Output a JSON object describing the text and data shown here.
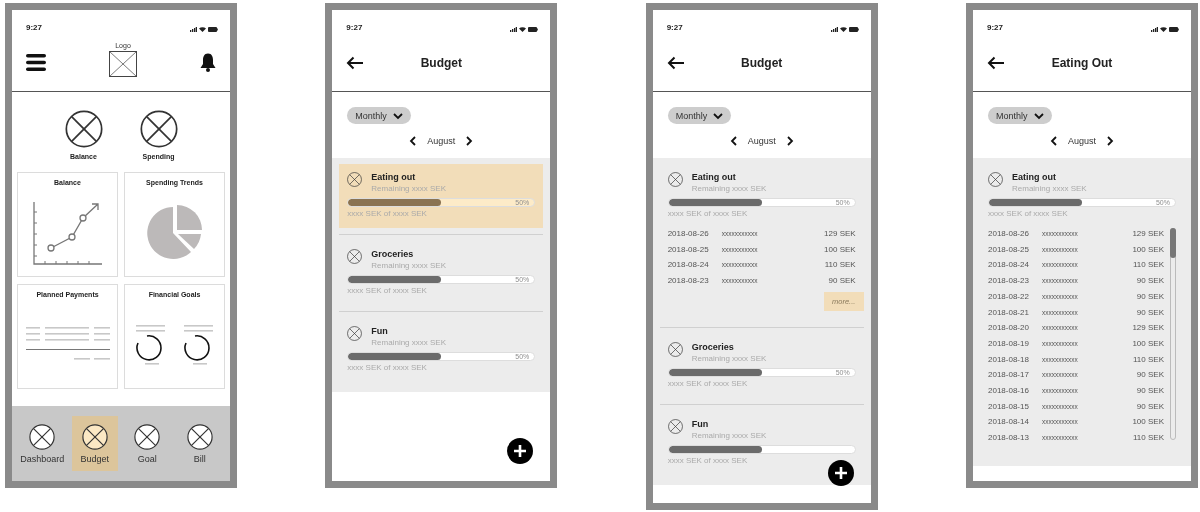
{
  "screens": [
    {
      "kind": "dashboard",
      "time": "9:27",
      "logo_label": "Logo",
      "summary": [
        "Balance",
        "Spending"
      ],
      "cards": [
        {
          "kind": "line",
          "title": "Balance"
        },
        {
          "kind": "pie",
          "title": "Spending Trends"
        },
        {
          "kind": "list",
          "title": "Planned Payments"
        },
        {
          "kind": "goals",
          "title": "Financial Goals"
        }
      ],
      "nav": [
        {
          "label": "Dashboard",
          "selected": false
        },
        {
          "label": "Budget",
          "selected": true
        },
        {
          "label": "Goal",
          "selected": false
        },
        {
          "label": "Bill",
          "selected": false
        }
      ]
    },
    {
      "kind": "budget",
      "time": "9:27",
      "title": "Budget",
      "period": "Monthly",
      "month": "August",
      "categories": [
        {
          "name": "Eating out",
          "remaining": "Remaining xxxx SEK",
          "level": 0.5,
          "percent": "50%",
          "amount": "xxxx SEK of xxxx SEK",
          "selected": true
        },
        {
          "name": "Groceries",
          "remaining": "Remaining xxxx SEK",
          "level": 0.5,
          "percent": "50%",
          "amount": "xxxx SEK of xxxx SEK",
          "selected": false
        },
        {
          "name": "Fun",
          "remaining": "Remaining xxxx SEK",
          "level": 0.5,
          "percent": "50%",
          "amount": "xxxx SEK of xxxx SEK",
          "selected": false
        }
      ]
    },
    {
      "kind": "budget",
      "time": "9:27",
      "title": "Budget",
      "period": "Monthly",
      "month": "August",
      "categories": [
        {
          "name": "Eating out",
          "remaining": "Remaining xxxx SEK",
          "level": 0.5,
          "percent": "50%",
          "amount": "xxxx SEK of xxxx SEK",
          "selected": false,
          "more": "more...",
          "transactions": [
            {
              "date": "2018-08-26",
              "description": "xxxxxxxxxxx",
              "amount": "129 SEK"
            },
            {
              "date": "2018-08-25",
              "description": "xxxxxxxxxxx",
              "amount": "100 SEK"
            },
            {
              "date": "2018-08-24",
              "description": "xxxxxxxxxxx",
              "amount": "110 SEK"
            },
            {
              "date": "2018-08-23",
              "description": "xxxxxxxxxxx",
              "amount": "90 SEK"
            }
          ]
        },
        {
          "name": "Groceries",
          "remaining": "Remaining xxxx SEK",
          "level": 0.5,
          "percent": "50%",
          "amount": "xxxx SEK of xxxx SEK",
          "selected": false
        },
        {
          "name": "Fun",
          "remaining": "Remaining xxxx SEK",
          "level": 0.5,
          "amount": "xxxx SEK of xxxx SEK",
          "selected": false
        }
      ]
    },
    {
      "kind": "detail",
      "time": "9:27",
      "title": "Eating Out",
      "period": "Monthly",
      "month": "August",
      "categories": [
        {
          "name": "Eating out",
          "remaining": "Remaining xxxx SEK",
          "level": 0.5,
          "percent": "50%",
          "amount": "xxxx SEK of xxxx SEK",
          "selected": false,
          "transactions": [
            {
              "date": "2018-08-26",
              "description": "xxxxxxxxxxx",
              "amount": "129 SEK"
            },
            {
              "date": "2018-08-25",
              "description": "xxxxxxxxxxx",
              "amount": "100 SEK"
            },
            {
              "date": "2018-08-24",
              "description": "xxxxxxxxxxx",
              "amount": "110 SEK"
            },
            {
              "date": "2018-08-23",
              "description": "xxxxxxxxxxx",
              "amount": "90 SEK"
            },
            {
              "date": "2018-08-22",
              "description": "xxxxxxxxxxx",
              "amount": "90 SEK"
            },
            {
              "date": "2018-08-21",
              "description": "xxxxxxxxxxx",
              "amount": "90 SEK"
            },
            {
              "date": "2018-08-20",
              "description": "xxxxxxxxxxx",
              "amount": "129 SEK"
            },
            {
              "date": "2018-08-19",
              "description": "xxxxxxxxxxx",
              "amount": "100 SEK"
            },
            {
              "date": "2018-08-18",
              "description": "xxxxxxxxxxx",
              "amount": "110 SEK"
            },
            {
              "date": "2018-08-17",
              "description": "xxxxxxxxxxx",
              "amount": "90 SEK"
            },
            {
              "date": "2018-08-16",
              "description": "xxxxxxxxxxx",
              "amount": "90 SEK"
            },
            {
              "date": "2018-08-15",
              "description": "xxxxxxxxxxx",
              "amount": "90 SEK"
            },
            {
              "date": "2018-08-14",
              "description": "xxxxxxxxxxx",
              "amount": "100 SEK"
            },
            {
              "date": "2018-08-13",
              "description": "xxxxxxxxxxx",
              "amount": "110 SEK"
            }
          ]
        }
      ]
    }
  ]
}
